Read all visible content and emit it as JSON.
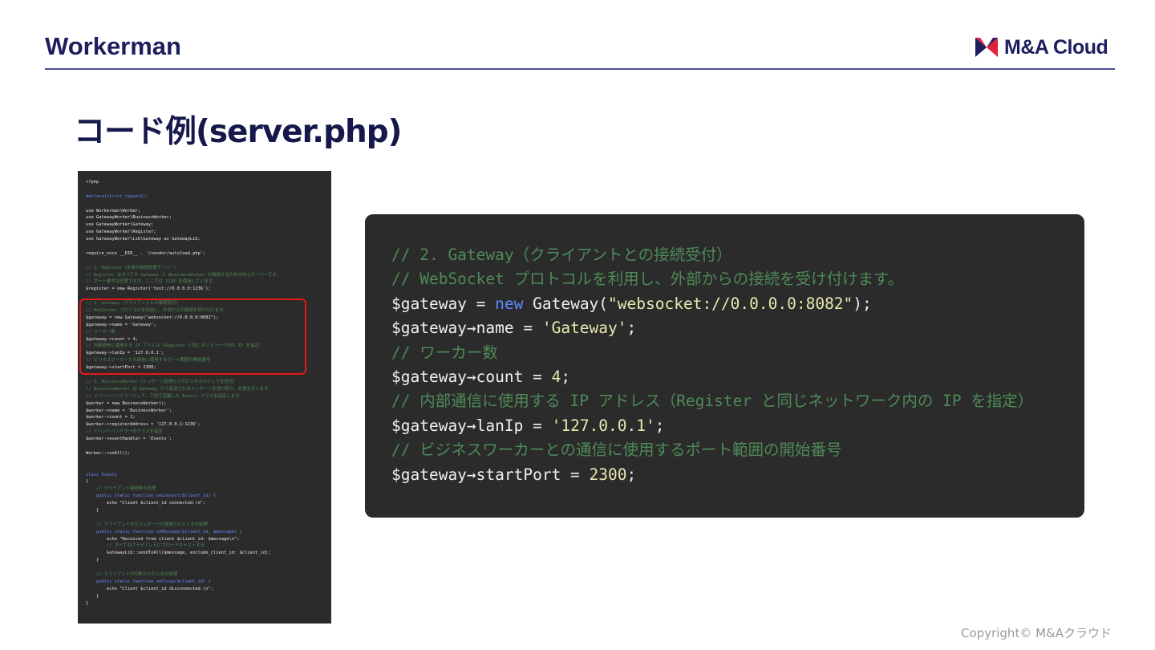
{
  "header": {
    "title": "Workerman",
    "logo_text": "M&A Cloud",
    "brand_colors": {
      "navy": "#1c1f5e",
      "red": "#e0223a"
    }
  },
  "slide": {
    "title": "コード例(server.php)"
  },
  "thumbnail": {
    "lines": [
      {
        "t": "<?php",
        "c": "var"
      },
      {
        "t": "",
        "c": "var"
      },
      {
        "t": "declare(strict_types=1);",
        "c": "kw"
      },
      {
        "t": "",
        "c": "var"
      },
      {
        "t": "use Workerman\\Worker;",
        "c": "var"
      },
      {
        "t": "use GatewayWorker\\BusinessWorker;",
        "c": "var"
      },
      {
        "t": "use GatewayWorker\\Gateway;",
        "c": "var"
      },
      {
        "t": "use GatewayWorker\\Register;",
        "c": "var"
      },
      {
        "t": "use GatewayWorker\\Lib\\Gateway as GatewayLib;",
        "c": "var"
      },
      {
        "t": "",
        "c": "var"
      },
      {
        "t": "require_once __DIR__ . '/vendor/autoload.php';",
        "c": "var"
      },
      {
        "t": "",
        "c": "var"
      },
      {
        "t": "// 1. Register（全体の接続管理サーバー）",
        "c": "cm"
      },
      {
        "t": "// Register はすべての Gateway と BusinessWorker が接続するための中心サーバーです。",
        "c": "cm"
      },
      {
        "t": "// ポート番号は任意ですが、ここでは 1236 を使用しています。",
        "c": "cm"
      },
      {
        "t": "$register = new Register('text://0.0.0.0:1236');",
        "c": "var"
      },
      {
        "t": "",
        "c": "var"
      },
      {
        "t": "// 2. Gateway（クライアントとの接続受付）",
        "c": "cm"
      },
      {
        "t": "// WebSocket プロトコルを利用し、外部からの接続を受け付けます。",
        "c": "cm"
      },
      {
        "t": "$gateway = new Gateway(\"websocket://0.0.0.0:8082\");",
        "c": "var"
      },
      {
        "t": "$gateway->name = 'Gateway';",
        "c": "var"
      },
      {
        "t": "// ワーカー数",
        "c": "cm"
      },
      {
        "t": "$gateway->count = 4;",
        "c": "var"
      },
      {
        "t": "// 内部通信に使用する IP アドレス（Register と同じネットワーク内の IP を指定）",
        "c": "cm"
      },
      {
        "t": "$gateway->lanIp = '127.0.0.1';",
        "c": "var"
      },
      {
        "t": "// ビジネスワーカーとの通信に使用するポート範囲の開始番号",
        "c": "cm"
      },
      {
        "t": "$gateway->startPort = 2300;",
        "c": "var"
      },
      {
        "t": "",
        "c": "var"
      },
      {
        "t": "// 3. BusinessWorker（メッセージ処理などのビジネスロジックを担当）",
        "c": "cm"
      },
      {
        "t": "// BusinessWorker は Gateway から転送されるメッセージを受け取り、処理を行います。",
        "c": "cm"
      },
      {
        "t": "// イベントハンドラーとして、下記で定義した Events クラスを指定します。",
        "c": "cm"
      },
      {
        "t": "$worker = new BusinessWorker();",
        "c": "var"
      },
      {
        "t": "$worker->name = 'BusinessWorker';",
        "c": "var"
      },
      {
        "t": "$worker->count = 2;",
        "c": "var"
      },
      {
        "t": "$worker->registerAddress = '127.0.0.1:1236';",
        "c": "var"
      },
      {
        "t": "// イベントハンドラーのクラスを指定",
        "c": "cm"
      },
      {
        "t": "$worker->eventHandler = 'Events';",
        "c": "var"
      },
      {
        "t": "",
        "c": "var"
      },
      {
        "t": "Worker::runAll();",
        "c": "var"
      },
      {
        "t": "",
        "c": "var"
      },
      {
        "t": "",
        "c": "var"
      },
      {
        "t": "class Events",
        "c": "kw"
      },
      {
        "t": "{",
        "c": "var"
      },
      {
        "t": "    // クライアント接続時の処理",
        "c": "cm"
      },
      {
        "t": "    public static function onConnect($client_id) {",
        "c": "kw"
      },
      {
        "t": "        echo \"Client $client_id connected.\\n\";",
        "c": "var"
      },
      {
        "t": "    }",
        "c": "var"
      },
      {
        "t": "",
        "c": "var"
      },
      {
        "t": "    // クライアントからメッセージが送信されたときの処理",
        "c": "cm"
      },
      {
        "t": "    public static function onMessage($client_id, $message) {",
        "c": "kw"
      },
      {
        "t": "        echo \"Received from client $client_id: $message\\n\";",
        "c": "var"
      },
      {
        "t": "        // すべてのクライアントにブロードキャストする",
        "c": "cm"
      },
      {
        "t": "        GatewayLib::sendToAll($message, exclude_client_id: $client_id);",
        "c": "var"
      },
      {
        "t": "    }",
        "c": "var"
      },
      {
        "t": "",
        "c": "var"
      },
      {
        "t": "    // クライアントが切断されたときの処理",
        "c": "cm"
      },
      {
        "t": "    public static function onClose($client_id) {",
        "c": "kw"
      },
      {
        "t": "        echo \"Client $client_id disconnected.\\n\";",
        "c": "var"
      },
      {
        "t": "    }",
        "c": "var"
      },
      {
        "t": "}",
        "c": "var"
      }
    ]
  },
  "code_panel": {
    "lines": [
      [
        {
          "t": "// 2. Gateway（クライアントとの接続受付）",
          "c": "cm"
        }
      ],
      [
        {
          "t": "// WebSocket プロトコルを利用し、外部からの接続を受け付けます。",
          "c": "cm"
        }
      ],
      [
        {
          "t": "$gateway = ",
          "c": "var"
        },
        {
          "t": "new",
          "c": "kw"
        },
        {
          "t": " Gateway(",
          "c": "var"
        },
        {
          "t": "\"websocket://0.0.0.0:8082\"",
          "c": "st"
        },
        {
          "t": ");",
          "c": "var"
        }
      ],
      [
        {
          "t": "$gateway→name = ",
          "c": "var"
        },
        {
          "t": "'Gateway'",
          "c": "st"
        },
        {
          "t": ";",
          "c": "var"
        }
      ],
      [
        {
          "t": "// ワーカー数",
          "c": "cm"
        }
      ],
      [
        {
          "t": "$gateway→count = ",
          "c": "var"
        },
        {
          "t": "4",
          "c": "num"
        },
        {
          "t": ";",
          "c": "var"
        }
      ],
      [
        {
          "t": "// 内部通信に使用する IP アドレス（Register と同じネットワーク内の IP を指定）",
          "c": "cm"
        }
      ],
      [
        {
          "t": "$gateway→lanIp = ",
          "c": "var"
        },
        {
          "t": "'127.0.0.1'",
          "c": "st"
        },
        {
          "t": ";",
          "c": "var"
        }
      ],
      [
        {
          "t": "// ビジネスワーカーとの通信に使用するポート範囲の開始番号",
          "c": "cm"
        }
      ],
      [
        {
          "t": "$gateway→startPort = ",
          "c": "var"
        },
        {
          "t": "2300",
          "c": "num"
        },
        {
          "t": ";",
          "c": "var"
        }
      ]
    ]
  },
  "footer": {
    "copyright": "Copyright© M&Aクラウド"
  }
}
